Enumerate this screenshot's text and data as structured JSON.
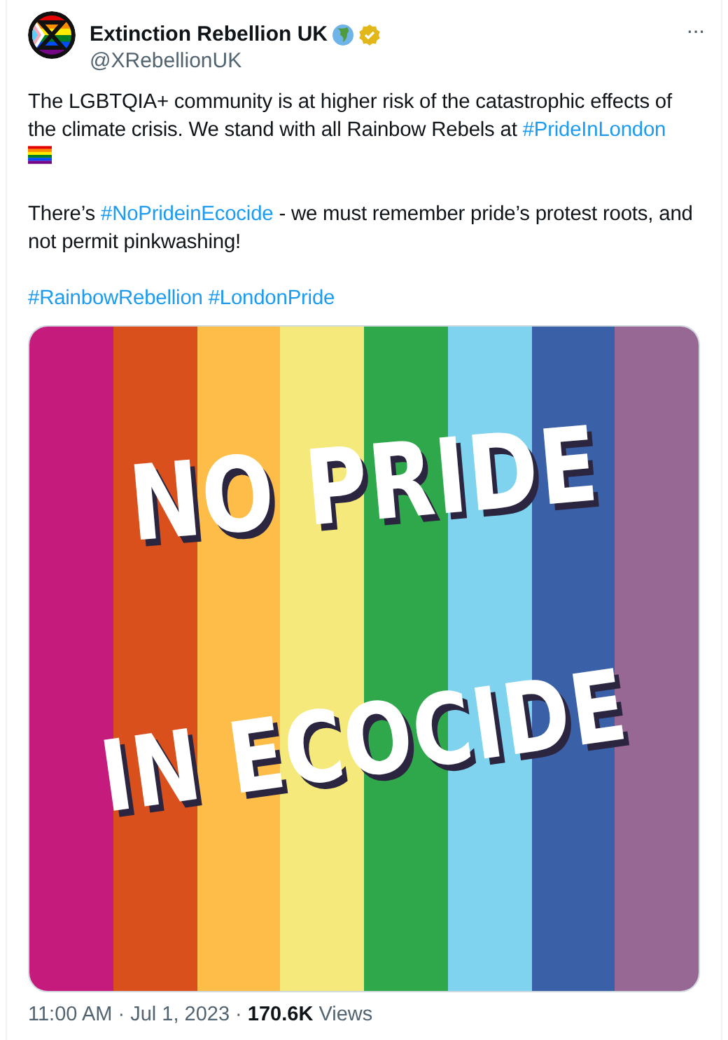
{
  "author": {
    "name": "Extinction Rebellion UK",
    "handle": "@XRebellionUK",
    "verified": true
  },
  "more_button": "···",
  "paragraphs": [
    [
      {
        "kind": "text",
        "text": "The LGBTQIA+ community is at higher risk of the catastrophic effects of the climate crisis. We stand with all Rainbow Rebels at "
      },
      {
        "kind": "hashtag",
        "text": "#PrideInLondon"
      },
      {
        "kind": "flag"
      }
    ],
    [
      {
        "kind": "text",
        "text": "There’s "
      },
      {
        "kind": "hashtag",
        "text": "#NoPrideinEcocide"
      },
      {
        "kind": "text",
        "text": " - we must remember pride’s protest roots, and not permit pinkwashing!"
      }
    ],
    [
      {
        "kind": "hashtag",
        "text": "#RainbowRebellion"
      },
      {
        "kind": "hashtag",
        "text": "#LondonPride"
      }
    ]
  ],
  "image": {
    "stripes": [
      {
        "color": "#c51b7d"
      },
      {
        "color": "#d9501c"
      },
      {
        "color": "#fdbd48"
      },
      {
        "color": "#f5e97b"
      },
      {
        "color": "#2ea84a"
      },
      {
        "color": "#7fd3ef"
      },
      {
        "color": "#3a60a8"
      },
      {
        "color": "#986895"
      }
    ],
    "lines": [
      "NO PRIDE",
      "IN ECOCIDE"
    ]
  },
  "footer": "11:00 AM · Jul 1, 2023 · **170.6K** Views"
}
